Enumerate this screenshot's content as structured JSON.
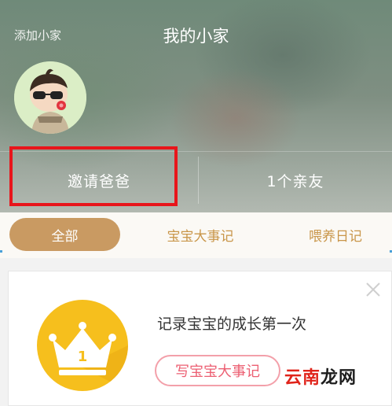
{
  "header": {
    "add_home_label": "添加小家",
    "title": "我的小家"
  },
  "stats": {
    "invite_label": "邀请爸爸",
    "relatives_label": "1个亲友"
  },
  "tabs": [
    {
      "label": "全部",
      "active": true
    },
    {
      "label": "宝宝大事记",
      "active": false
    },
    {
      "label": "喂养日记",
      "active": false
    }
  ],
  "card": {
    "badge_number": "1",
    "message": "记录宝宝的成长第一次",
    "button_label": "写宝宝大事记"
  },
  "watermark": {
    "part1": "云南",
    "part2": "龙网"
  },
  "colors": {
    "accent_tab": "#c99a62",
    "tab_text": "#c9964a",
    "highlight": "#e8151b",
    "crown_bg": "#f6bf1d",
    "button_pink": "#ec5f72"
  },
  "icons": {
    "avatar": "cartoon-baby-with-sunglasses",
    "badge": "crown-icon",
    "close": "close-icon"
  }
}
